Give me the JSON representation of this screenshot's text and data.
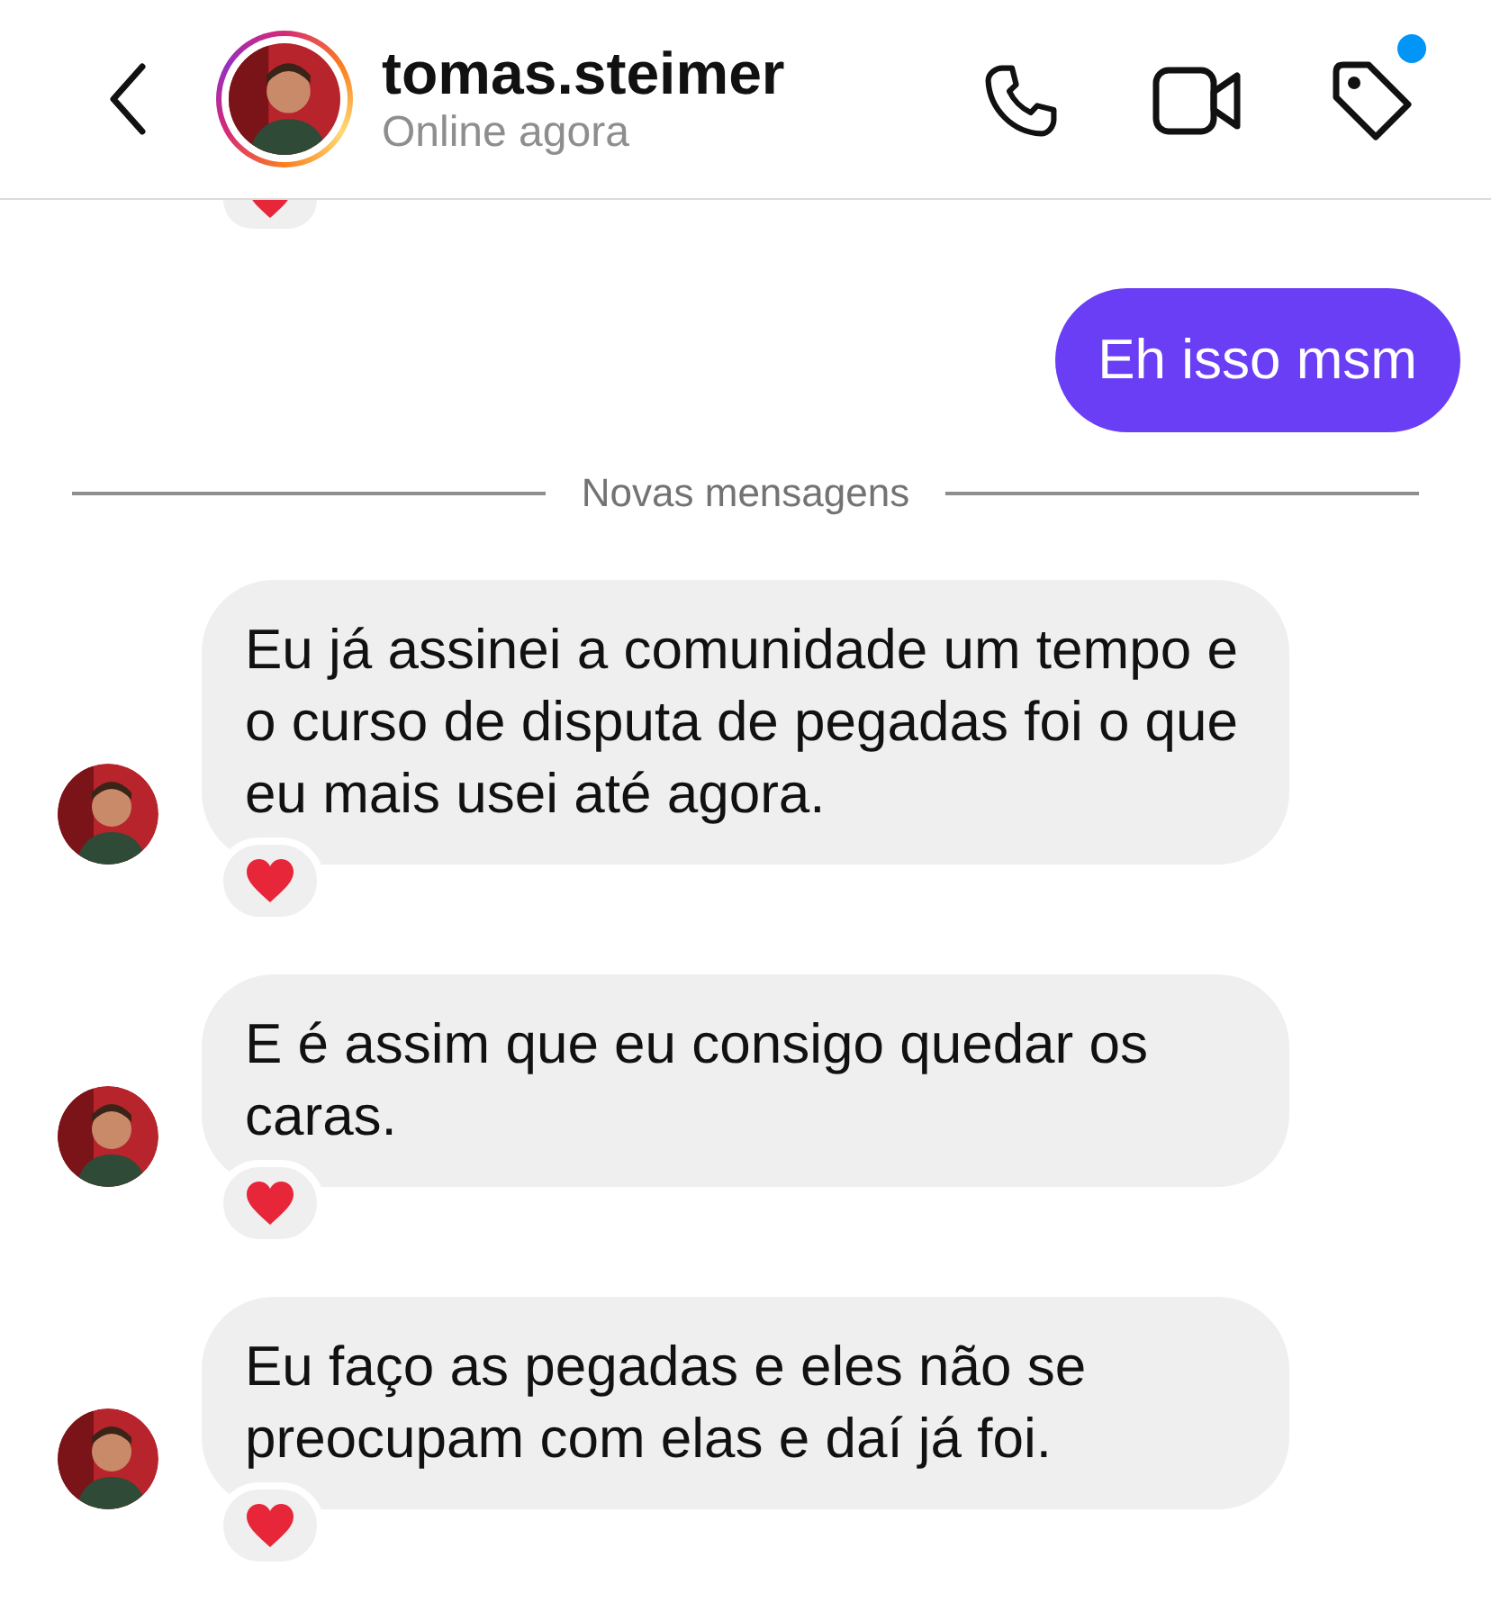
{
  "header": {
    "title": "tomas.steimer",
    "status": "Online agora",
    "has_story": true,
    "notification_dot": true
  },
  "top_reaction": {
    "reacted": true
  },
  "messages": [
    {
      "kind": "sent",
      "text": "Eh isso msm",
      "reacted": false
    },
    {
      "kind": "divider",
      "text": "Novas mensagens"
    },
    {
      "kind": "received",
      "text": "Eu já assinei a comunidade um tempo e o curso de disputa de pegadas foi o que eu mais usei até agora.",
      "reacted": true
    },
    {
      "kind": "received",
      "text": "E é assim que eu consigo quedar os caras.",
      "reacted": true
    },
    {
      "kind": "received",
      "text": "Eu faço as pegadas e eles não se preocupam com elas e daí já foi.",
      "reacted": true
    }
  ]
}
